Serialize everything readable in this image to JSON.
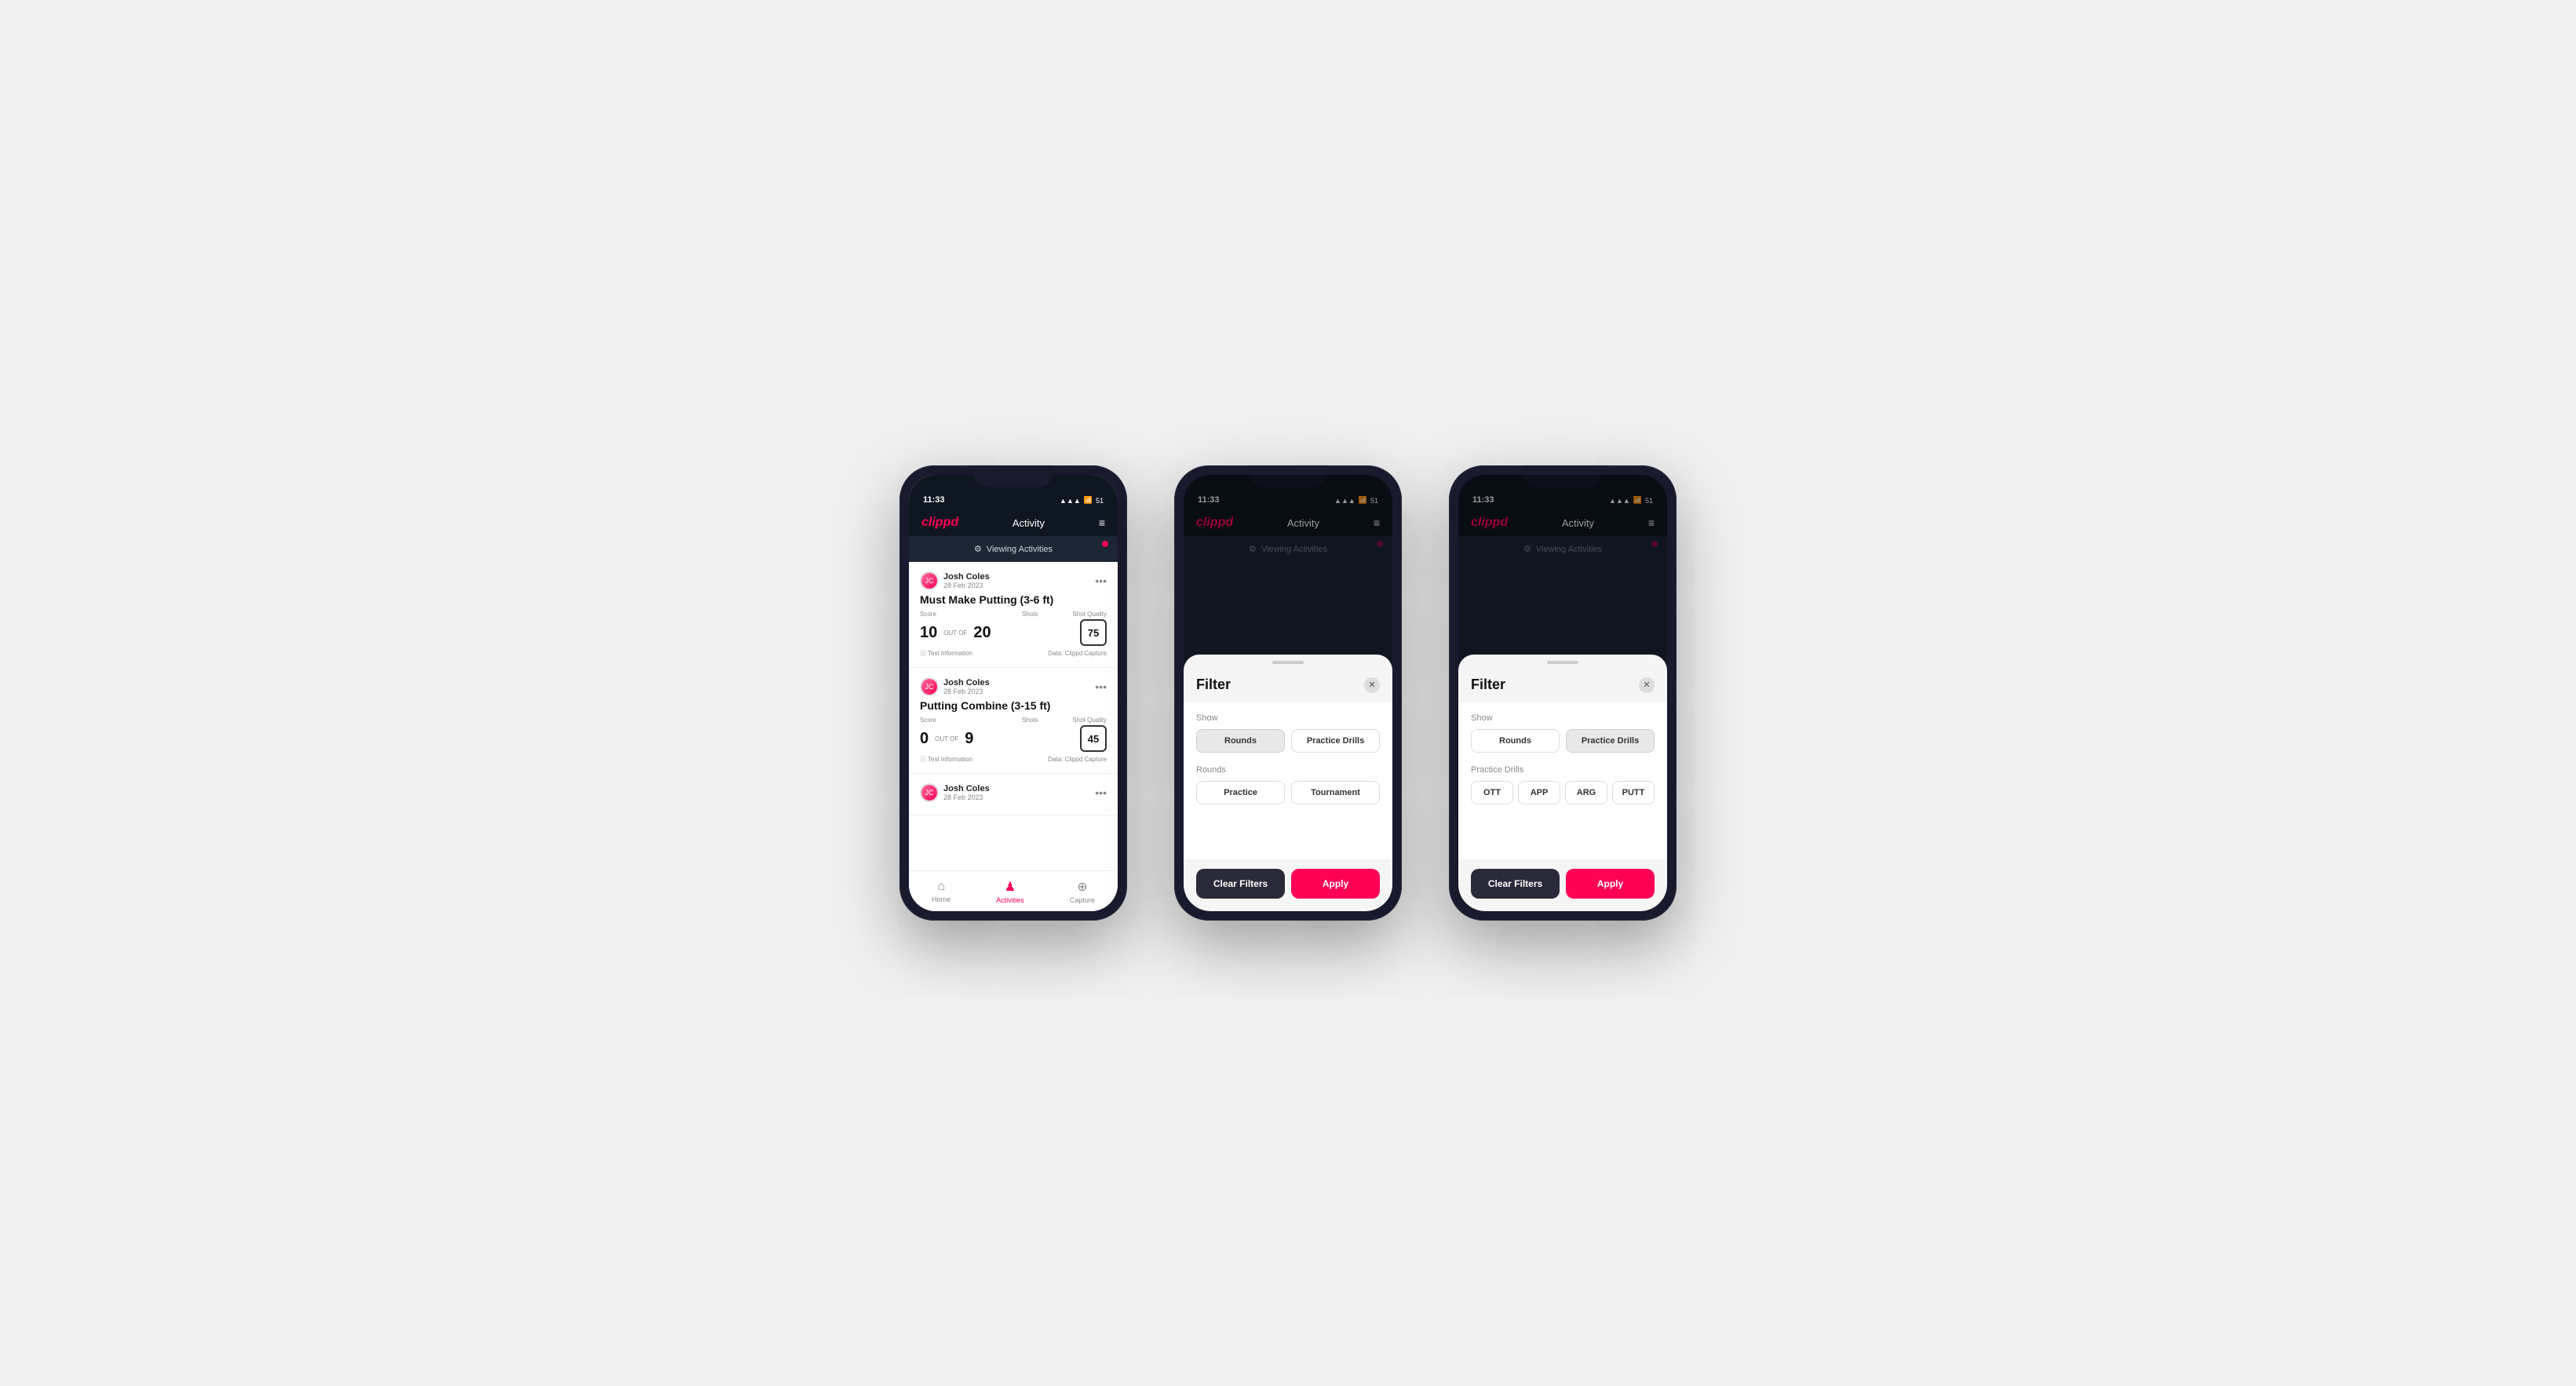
{
  "phones": [
    {
      "id": "phone1",
      "type": "activity-list",
      "status": {
        "time": "11:33",
        "signal": "▲▲▲",
        "wifi": "wifi",
        "battery": "51"
      },
      "header": {
        "logo": "clippd",
        "title": "Activity",
        "menu_icon": "≡"
      },
      "viewing_banner": {
        "label": "Viewing Activities",
        "icon": "⚙"
      },
      "activities": [
        {
          "user_name": "Josh Coles",
          "user_date": "28 Feb 2023",
          "title": "Must Make Putting (3-6 ft)",
          "score_label": "Score",
          "score_value": "10",
          "out_of": "OUT OF",
          "shots_label": "Shots",
          "shots_value": "20",
          "shot_quality_label": "Shot Quality",
          "shot_quality_value": "75",
          "footer_left": "Test Information",
          "footer_right": "Data: Clippd Capture"
        },
        {
          "user_name": "Josh Coles",
          "user_date": "28 Feb 2023",
          "title": "Putting Combine (3-15 ft)",
          "score_label": "Score",
          "score_value": "0",
          "out_of": "OUT OF",
          "shots_label": "Shots",
          "shots_value": "9",
          "shot_quality_label": "Shot Quality",
          "shot_quality_value": "45",
          "footer_left": "Test Information",
          "footer_right": "Data: Clippd Capture"
        },
        {
          "user_name": "Josh Coles",
          "user_date": "28 Feb 2023",
          "title": "",
          "score_label": "",
          "score_value": "",
          "out_of": "",
          "shots_label": "",
          "shots_value": "",
          "shot_quality_label": "",
          "shot_quality_value": "",
          "footer_left": "",
          "footer_right": ""
        }
      ],
      "nav": {
        "items": [
          {
            "label": "Home",
            "icon": "⌂",
            "active": false
          },
          {
            "label": "Activities",
            "icon": "♟",
            "active": true
          },
          {
            "label": "Capture",
            "icon": "⊕",
            "active": false
          }
        ]
      }
    },
    {
      "id": "phone2",
      "type": "filter-rounds",
      "status": {
        "time": "11:33"
      },
      "header": {
        "logo": "clippd",
        "title": "Activity"
      },
      "viewing_banner": {
        "label": "Viewing Activities"
      },
      "filter": {
        "title": "Filter",
        "show_label": "Show",
        "show_buttons": [
          {
            "label": "Rounds",
            "selected": true
          },
          {
            "label": "Practice Drills",
            "selected": false
          }
        ],
        "rounds_label": "Rounds",
        "rounds_buttons": [
          {
            "label": "Practice",
            "selected": false
          },
          {
            "label": "Tournament",
            "selected": false
          }
        ],
        "clear_label": "Clear Filters",
        "apply_label": "Apply"
      }
    },
    {
      "id": "phone3",
      "type": "filter-drills",
      "status": {
        "time": "11:33"
      },
      "header": {
        "logo": "clippd",
        "title": "Activity"
      },
      "viewing_banner": {
        "label": "Viewing Activities"
      },
      "filter": {
        "title": "Filter",
        "show_label": "Show",
        "show_buttons": [
          {
            "label": "Rounds",
            "selected": false
          },
          {
            "label": "Practice Drills",
            "selected": true
          }
        ],
        "drills_label": "Practice Drills",
        "drills_buttons": [
          {
            "label": "OTT",
            "selected": false
          },
          {
            "label": "APP",
            "selected": false
          },
          {
            "label": "ARG",
            "selected": false
          },
          {
            "label": "PUTT",
            "selected": false
          }
        ],
        "clear_label": "Clear Filters",
        "apply_label": "Apply"
      }
    }
  ]
}
